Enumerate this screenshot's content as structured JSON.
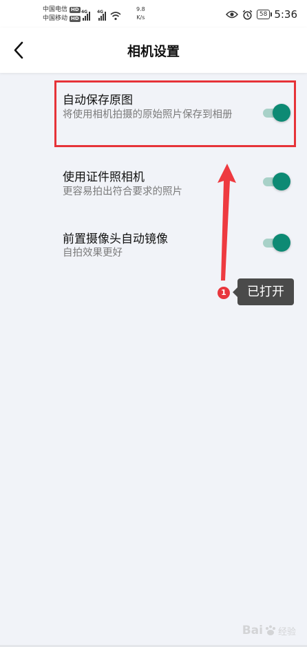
{
  "status_bar": {
    "carrier_1": "中国电信",
    "carrier_2": "中国移动",
    "hd_label": "HD",
    "net_type": "4G",
    "speed_value": "9.8",
    "speed_unit": "K/s",
    "battery": "58",
    "time": "5:36"
  },
  "header": {
    "title": "相机设置",
    "back_icon": "chevron-left-icon"
  },
  "settings": [
    {
      "title": "自动保存原图",
      "desc": "将使用相机拍摄的原始照片保存到相册",
      "enabled": true
    },
    {
      "title": "使用证件照相机",
      "desc": "更容易拍出符合要求的照片",
      "enabled": true
    },
    {
      "title": "前置摄像头自动镜像",
      "desc": "自拍效果更好",
      "enabled": true
    }
  ],
  "annotation": {
    "step_number": "1",
    "callout_text": "已打开",
    "highlight_color": "#e63238"
  },
  "watermark": {
    "brand": "Bai",
    "brand_2": "经验"
  },
  "colors": {
    "toggle_on": "#0d8a74",
    "toggle_track": "#a8d1c8",
    "background": "#f1f3f8"
  }
}
